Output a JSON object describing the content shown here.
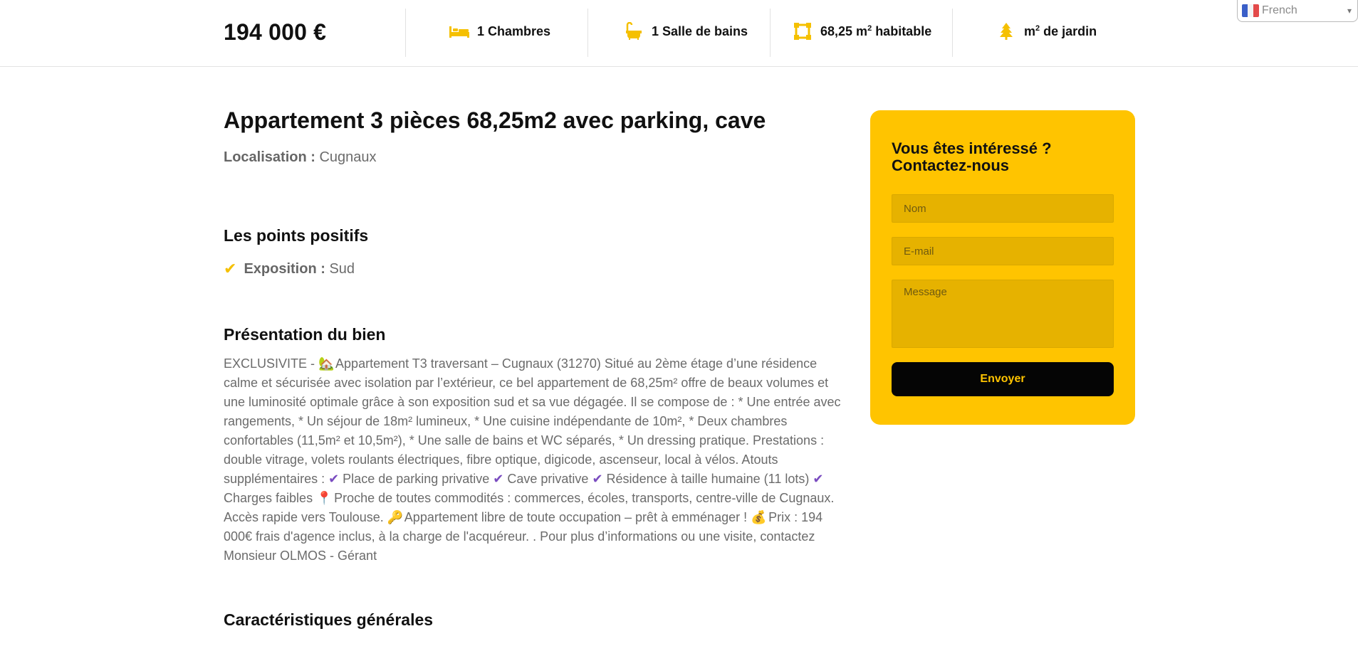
{
  "topbar": {
    "price": "194 000 €",
    "stats": [
      {
        "icon": "bed-icon",
        "label": "1 Chambres"
      },
      {
        "icon": "bathtub-icon",
        "label": "1 Salle de bains"
      },
      {
        "icon": "area-icon",
        "label_prefix": "68,25 m",
        "label_sup": "2",
        "label_suffix": " habitable"
      },
      {
        "icon": "tree-icon",
        "label_prefix": "m",
        "label_sup": "2",
        "label_suffix": " de jardin"
      }
    ],
    "accent": "#f5c000"
  },
  "language": {
    "selected": "French"
  },
  "listing": {
    "title": "Appartement 3 pièces 68,25m2 avec parking, cave",
    "location_label": "Localisation :",
    "location_value": " Cugnaux"
  },
  "positives": {
    "title": "Les points positifs",
    "items": [
      {
        "label": "Exposition :",
        "value": " Sud"
      }
    ]
  },
  "presentation": {
    "title": "Présentation du bien",
    "seg1": "EXCLUSIVITE - ",
    "seg2": " Appartement T3 traversant – Cugnaux (31270) Situé au 2ème étage d’une résidence calme et sécurisée avec isolation par l’extérieur, ce bel appartement de 68,25m² offre de beaux volumes et une luminosité optimale grâce à son exposition sud et sa vue dégagée. Il se compose de : * Une entrée avec rangements, * Un séjour de 18m² lumineux, * Une cuisine indépendante de 10m², * Deux chambres confortables (11,5m² et 10,5m²), * Une salle de bains et WC séparés, * Un dressing pratique. Prestations : double vitrage, volets roulants électriques, fibre optique, digicode, ascenseur, local à vélos. Atouts supplémentaires : ",
    "seg3": " Place de parking privative ",
    "seg4": " Cave privative ",
    "seg5": " Résidence à taille humaine (11 lots) ",
    "seg6": " Charges faibles ",
    "seg7": " Proche de toutes commodités : commerces, écoles, transports, centre-ville de Cugnaux. Accès rapide vers Toulouse. ",
    "seg8": " Appartement libre de toute occupation – prêt à emménager ! ",
    "seg9": " Prix : 194 000€ frais d'agence inclus, à la charge de l'acquéreur. . Pour plus d’informations ou une visite, contactez Monsieur OLMOS - Gérant"
  },
  "characteristics": {
    "title": "Caractéristiques générales"
  },
  "contact": {
    "title_line1": "Vous êtes intéressé ?",
    "title_line2": "Contactez-nous",
    "name_placeholder": "Nom",
    "email_placeholder": "E-mail",
    "message_placeholder": "Message",
    "submit_label": "Envoyer",
    "card_color": "#ffc400"
  }
}
